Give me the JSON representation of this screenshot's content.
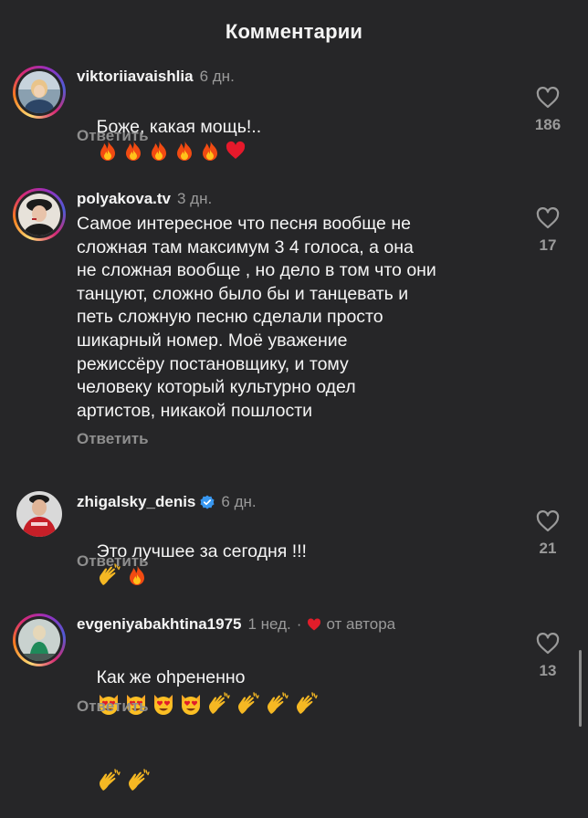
{
  "header": {
    "title": "Комментарии"
  },
  "comments": [
    {
      "username": "viktoriiavaishlia",
      "time": "6 дн.",
      "text": "Боже, какая мощь!..",
      "emojis": [
        "fire",
        "fire",
        "fire",
        "fire",
        "fire",
        "red-heart"
      ],
      "reply_label": "Ответить",
      "likes": "186"
    },
    {
      "username": "polyakova.tv",
      "time": "3 дн.",
      "text": "Самое интересное что песня вообще не\nсложная там максимум 3 4 голоса, а она\nне сложная вообще , но дело в том что они\nтанцуют, сложно было бы и танцевать и\nпеть сложную песню сделали просто\nшикарный номер. Моё уважение\nрежиссёру постановщику, и тому\nчеловеку который культурно одел\nартистов, никакой пошлости",
      "reply_label": "Ответить",
      "likes": "17"
    },
    {
      "username": "zhigalsky_denis",
      "verified": true,
      "time": "6 дн.",
      "text": "Это лучшее за сегодня !!!",
      "emojis": [
        "clapping-hands",
        "fire"
      ],
      "reply_label": "Ответить",
      "likes": "21"
    },
    {
      "username": "evgeniyabakhtina1975",
      "time": "1 нед.",
      "separator": "·",
      "author_badge": "от автора",
      "text": "Как же оhрененно",
      "emojis": [
        "heart-eyes-cat",
        "heart-eyes-cat",
        "heart-eyes-cat",
        "heart-eyes-cat",
        "clapping-hands",
        "clapping-hands",
        "clapping-hands",
        "clapping-hands",
        "clapping-hands",
        "clapping-hands"
      ],
      "reply_label": "Ответить",
      "likes": "13"
    }
  ],
  "colors": {
    "background": "#262628",
    "text": "#f5f5f5",
    "muted": "#9a9a9a",
    "verified": "#3897f0",
    "heart": "#e11d2a"
  }
}
